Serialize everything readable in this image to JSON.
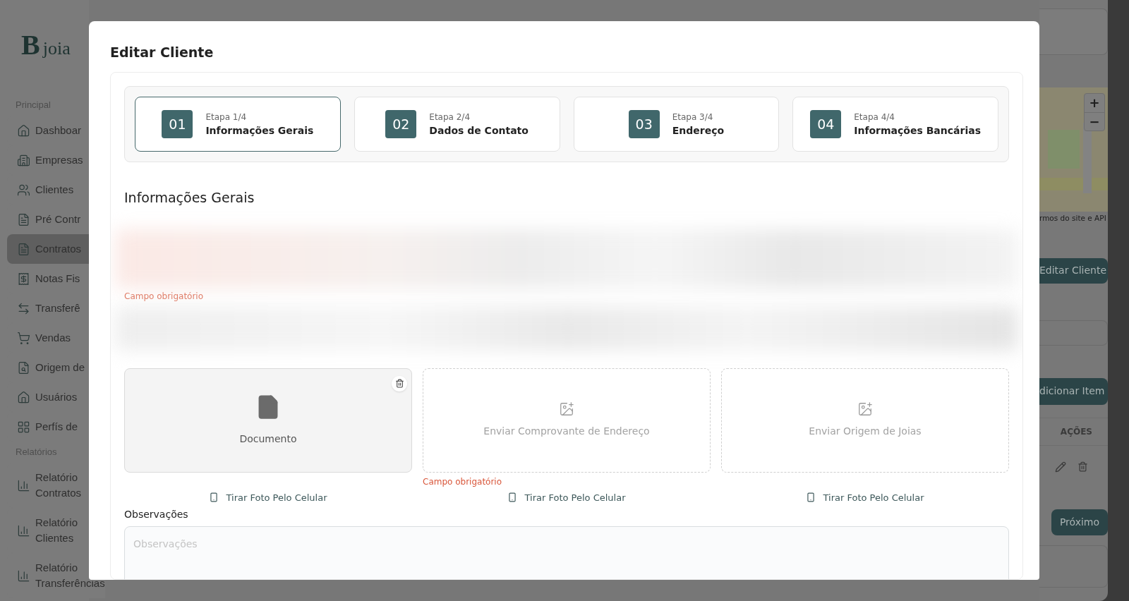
{
  "logo": {
    "mark": "B",
    "text": "joia"
  },
  "sidebar": {
    "sections": [
      {
        "title": "Principal",
        "items": [
          {
            "lines": [
              "Dashboar"
            ],
            "selected": false
          },
          {
            "lines": [
              "Empresas"
            ],
            "selected": false
          },
          {
            "lines": [
              "Clientes"
            ],
            "selected": false
          },
          {
            "lines": [
              "Pré Contr"
            ],
            "selected": false
          },
          {
            "lines": [
              "Contratos"
            ],
            "selected": true
          },
          {
            "lines": [
              "Notas Fis"
            ],
            "selected": false
          },
          {
            "lines": [
              "Transferê"
            ],
            "selected": false
          },
          {
            "lines": [
              "Vendas"
            ],
            "selected": false
          },
          {
            "lines": [
              "Origem de"
            ],
            "selected": false
          },
          {
            "lines": [
              "Usuários"
            ],
            "selected": false
          },
          {
            "lines": [
              "Perfís de"
            ],
            "selected": false
          }
        ]
      },
      {
        "title": "Relatórios",
        "items": [
          {
            "lines": [
              "Relatório",
              "Contratos"
            ],
            "selected": false
          },
          {
            "lines": [
              "Relatório",
              "Clientes"
            ],
            "selected": false
          },
          {
            "lines": [
              "Relatório",
              "Transferências"
            ],
            "selected": false
          }
        ]
      }
    ]
  },
  "background": {
    "map": {
      "zoom_in": "+",
      "zoom_out": "−",
      "attribution": "rmos do site e API"
    },
    "edit_button": "Editar Cliente",
    "add_item_button": "dicionar Item",
    "actions_header": "AÇÕES",
    "next_button": "Próximo"
  },
  "modal": {
    "title": "Editar Cliente",
    "steps": [
      {
        "number": "01",
        "label": "Etapa 1/4",
        "title": "Informações Gerais",
        "selected": true
      },
      {
        "number": "02",
        "label": "Etapa 2/4",
        "title": "Dados de Contato",
        "selected": false
      },
      {
        "number": "03",
        "label": "Etapa 3/4",
        "title": "Endereço",
        "selected": false
      },
      {
        "number": "04",
        "label": "Etapa 4/4",
        "title": "Informações Bancárias",
        "selected": false
      }
    ],
    "section_title": "Informações Gerais",
    "field_error": "Campo obrigatório",
    "uploads": [
      {
        "kind": "file",
        "label": "Documento",
        "camera": "Tirar Foto Pelo Celular"
      },
      {
        "kind": "empty",
        "label": "Enviar Comprovante de Endereço",
        "error": "Campo obrigatório",
        "camera": "Tirar Foto Pelo Celular"
      },
      {
        "kind": "empty",
        "label": "Enviar Origem de Joias",
        "camera": "Tirar Foto Pelo Celular"
      }
    ],
    "notes": {
      "label": "Observações",
      "placeholder": "Observações"
    }
  }
}
